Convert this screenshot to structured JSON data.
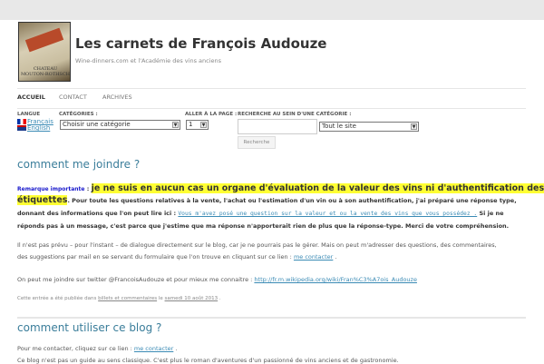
{
  "header": {
    "title": "Les carnets de François Audouze",
    "subtitle": "Wine-dinners.com et l'Académie des vins anciens",
    "logo_text": "CHATEAU MOUTON-ROTHSCHILD"
  },
  "nav": [
    {
      "label": "ACCUEIL"
    },
    {
      "label": "CONTACT"
    },
    {
      "label": "ARCHIVES"
    }
  ],
  "filters": {
    "langue_label": "LANGUE",
    "lang_fr": "Français",
    "lang_en": "English",
    "categories_label": "CATÉGORIES :",
    "categories_value": "Choisir une catégorie",
    "page_label": "ALLER À LA PAGE :",
    "page_value": "1",
    "search_label": "RECHERCHE AU SEIN D'UNE CATÉGORIE :",
    "search_value": "",
    "scope_value": "Tout le site",
    "search_button": "Recherche"
  },
  "post1": {
    "title": "comment me joindre ?",
    "remark_label": "Remarque importante",
    "remark_sep": " : ",
    "highlight_a": "je ne suis en aucun cas un organe d'évaluation de la valeur des vins ni d'authentification des",
    "highlight_b": "étiquettes",
    "p1_a": ". Pour toute les questions relatives à la vente, l'achat ou l'estimation d'un vin ou à son authentification, j'ai préparé une réponse type,",
    "p1_b": "donnant des informations que l'on peut lire ici : ",
    "p1_link": "Vous m'avez posé une question sur la valeur et ou la vente des vins que vous possédez .",
    "p1_c": " Si je ne",
    "p1_d": "réponds pas à un message, c'est parce que j'estime que ma réponse n'apporterait rien de plus que la réponse-type. Merci de votre compréhension.",
    "p2_a": "Il n'est pas prévu – pour l'instant – de dialogue directement sur le blog, car je ne pourrais pas le gérer. Mais on peut m'adresser des questions, des commentaires,",
    "p2_b": "des suggestions par mail en se servant du formulaire que l'on trouve en cliquant sur ce lien : ",
    "p2_link": "me contacter",
    "p2_end": " .",
    "p3": "On peut me joindre sur twitter  @FrancoisAudouze  et pour mieux me connaitre : ",
    "p3_link": "http://fr.m.wikipedia.org/wiki/Fran%C3%A7ois_Audouze",
    "meta_a": "Cette entrée a été publiée dans ",
    "meta_cat": "billets et commentaires",
    "meta_b": " le ",
    "meta_date": "samedi 10 août 2013",
    "meta_end": " ."
  },
  "post2": {
    "title": "comment utiliser ce blog ?",
    "p1": "Pour me contacter, cliquez sur ce lien : ",
    "p1_link": "me contacter",
    "p1_end": " .",
    "p2": "Ce blog n'est pas un guide au sens classique. C'est plus le roman d'aventures d'un passionné de vins anciens et de gastronomie."
  }
}
